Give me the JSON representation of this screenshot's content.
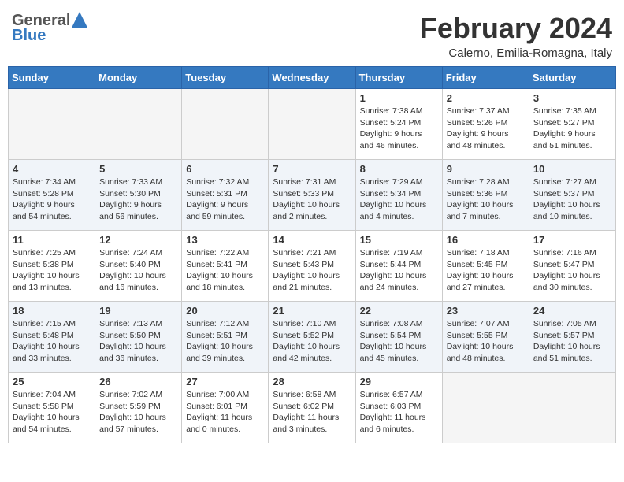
{
  "header": {
    "logo": {
      "line1": "General",
      "line2": "Blue"
    },
    "title": "February 2024",
    "location": "Calerno, Emilia-Romagna, Italy"
  },
  "weekdays": [
    "Sunday",
    "Monday",
    "Tuesday",
    "Wednesday",
    "Thursday",
    "Friday",
    "Saturday"
  ],
  "weeks": [
    [
      {
        "day": "",
        "content": ""
      },
      {
        "day": "",
        "content": ""
      },
      {
        "day": "",
        "content": ""
      },
      {
        "day": "",
        "content": ""
      },
      {
        "day": "1",
        "content": "Sunrise: 7:38 AM\nSunset: 5:24 PM\nDaylight: 9 hours and 46 minutes."
      },
      {
        "day": "2",
        "content": "Sunrise: 7:37 AM\nSunset: 5:26 PM\nDaylight: 9 hours and 48 minutes."
      },
      {
        "day": "3",
        "content": "Sunrise: 7:35 AM\nSunset: 5:27 PM\nDaylight: 9 hours and 51 minutes."
      }
    ],
    [
      {
        "day": "4",
        "content": "Sunrise: 7:34 AM\nSunset: 5:28 PM\nDaylight: 9 hours and 54 minutes."
      },
      {
        "day": "5",
        "content": "Sunrise: 7:33 AM\nSunset: 5:30 PM\nDaylight: 9 hours and 56 minutes."
      },
      {
        "day": "6",
        "content": "Sunrise: 7:32 AM\nSunset: 5:31 PM\nDaylight: 9 hours and 59 minutes."
      },
      {
        "day": "7",
        "content": "Sunrise: 7:31 AM\nSunset: 5:33 PM\nDaylight: 10 hours and 2 minutes."
      },
      {
        "day": "8",
        "content": "Sunrise: 7:29 AM\nSunset: 5:34 PM\nDaylight: 10 hours and 4 minutes."
      },
      {
        "day": "9",
        "content": "Sunrise: 7:28 AM\nSunset: 5:36 PM\nDaylight: 10 hours and 7 minutes."
      },
      {
        "day": "10",
        "content": "Sunrise: 7:27 AM\nSunset: 5:37 PM\nDaylight: 10 hours and 10 minutes."
      }
    ],
    [
      {
        "day": "11",
        "content": "Sunrise: 7:25 AM\nSunset: 5:38 PM\nDaylight: 10 hours and 13 minutes."
      },
      {
        "day": "12",
        "content": "Sunrise: 7:24 AM\nSunset: 5:40 PM\nDaylight: 10 hours and 16 minutes."
      },
      {
        "day": "13",
        "content": "Sunrise: 7:22 AM\nSunset: 5:41 PM\nDaylight: 10 hours and 18 minutes."
      },
      {
        "day": "14",
        "content": "Sunrise: 7:21 AM\nSunset: 5:43 PM\nDaylight: 10 hours and 21 minutes."
      },
      {
        "day": "15",
        "content": "Sunrise: 7:19 AM\nSunset: 5:44 PM\nDaylight: 10 hours and 24 minutes."
      },
      {
        "day": "16",
        "content": "Sunrise: 7:18 AM\nSunset: 5:45 PM\nDaylight: 10 hours and 27 minutes."
      },
      {
        "day": "17",
        "content": "Sunrise: 7:16 AM\nSunset: 5:47 PM\nDaylight: 10 hours and 30 minutes."
      }
    ],
    [
      {
        "day": "18",
        "content": "Sunrise: 7:15 AM\nSunset: 5:48 PM\nDaylight: 10 hours and 33 minutes."
      },
      {
        "day": "19",
        "content": "Sunrise: 7:13 AM\nSunset: 5:50 PM\nDaylight: 10 hours and 36 minutes."
      },
      {
        "day": "20",
        "content": "Sunrise: 7:12 AM\nSunset: 5:51 PM\nDaylight: 10 hours and 39 minutes."
      },
      {
        "day": "21",
        "content": "Sunrise: 7:10 AM\nSunset: 5:52 PM\nDaylight: 10 hours and 42 minutes."
      },
      {
        "day": "22",
        "content": "Sunrise: 7:08 AM\nSunset: 5:54 PM\nDaylight: 10 hours and 45 minutes."
      },
      {
        "day": "23",
        "content": "Sunrise: 7:07 AM\nSunset: 5:55 PM\nDaylight: 10 hours and 48 minutes."
      },
      {
        "day": "24",
        "content": "Sunrise: 7:05 AM\nSunset: 5:57 PM\nDaylight: 10 hours and 51 minutes."
      }
    ],
    [
      {
        "day": "25",
        "content": "Sunrise: 7:04 AM\nSunset: 5:58 PM\nDaylight: 10 hours and 54 minutes."
      },
      {
        "day": "26",
        "content": "Sunrise: 7:02 AM\nSunset: 5:59 PM\nDaylight: 10 hours and 57 minutes."
      },
      {
        "day": "27",
        "content": "Sunrise: 7:00 AM\nSunset: 6:01 PM\nDaylight: 11 hours and 0 minutes."
      },
      {
        "day": "28",
        "content": "Sunrise: 6:58 AM\nSunset: 6:02 PM\nDaylight: 11 hours and 3 minutes."
      },
      {
        "day": "29",
        "content": "Sunrise: 6:57 AM\nSunset: 6:03 PM\nDaylight: 11 hours and 6 minutes."
      },
      {
        "day": "",
        "content": ""
      },
      {
        "day": "",
        "content": ""
      }
    ]
  ]
}
